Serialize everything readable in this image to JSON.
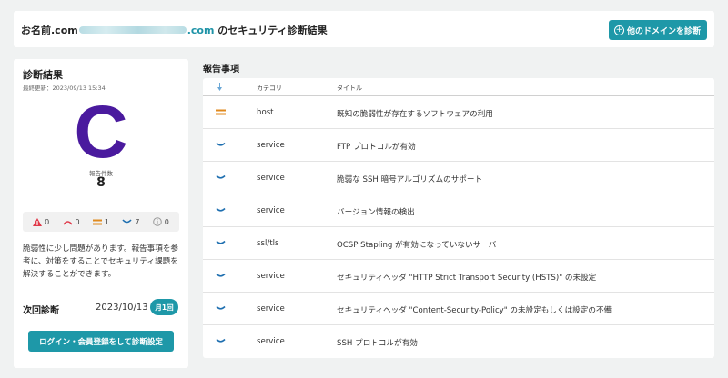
{
  "header": {
    "title_prefix": "お名前.com",
    "domain_suffix": ".com",
    "title_suffix": " のセキュリティ診断結果",
    "add_domain_button": "他のドメインを診断"
  },
  "summary_panel": {
    "title": "診断結果",
    "last_updated": "最終更新：2023/09/13 15:34",
    "grade": "C",
    "report_count_label": "報告件数",
    "report_count": "8",
    "severity_counts": [
      {
        "name": "critical",
        "icon": "warning-triangle-icon",
        "count": "0",
        "color": "#e03a4a"
      },
      {
        "name": "high",
        "icon": "high-arc-icon",
        "count": "0",
        "color": "#e03a4a"
      },
      {
        "name": "medium",
        "icon": "medium-equals-icon",
        "count": "1",
        "color": "#e08a1e"
      },
      {
        "name": "low",
        "icon": "low-chevron-icon",
        "count": "7",
        "color": "#1e6fb0"
      },
      {
        "name": "info",
        "icon": "info-circle-icon",
        "count": "0",
        "color": "#999999"
      }
    ],
    "summary_text": "脆弱性に少し問題があります。報告事項を参考に、対策をすることでセキュリティ課題を解決することができます。",
    "next_scan_label": "次回診断",
    "next_scan_date": "2023/10/13",
    "next_scan_badge": "月1回",
    "login_button": "ログイン・会員登録をして診断設定"
  },
  "report": {
    "section_title": "報告事項",
    "columns": {
      "category": "カテゴリ",
      "title": "タイトル"
    },
    "rows": [
      {
        "severity": "medium",
        "category": "host",
        "title": "既知の脆弱性が存在するソフトウェアの利用"
      },
      {
        "severity": "low",
        "category": "service",
        "title": "FTP プロトコルが有効"
      },
      {
        "severity": "low",
        "category": "service",
        "title": "脆弱な SSH 暗号アルゴリズムのサポート"
      },
      {
        "severity": "low",
        "category": "service",
        "title": "バージョン情報の検出"
      },
      {
        "severity": "low",
        "category": "ssl/tls",
        "title": "OCSP Stapling が有効になっていないサーバ"
      },
      {
        "severity": "low",
        "category": "service",
        "title": "セキュリティヘッダ \"HTTP Strict Transport Security (HSTS)\" の未設定"
      },
      {
        "severity": "low",
        "category": "service",
        "title": "セキュリティヘッダ \"Content-Security-Policy\" の未設定もしくは設定の不備"
      },
      {
        "severity": "low",
        "category": "service",
        "title": "SSH プロトコルが有効"
      }
    ]
  },
  "colors": {
    "accent": "#1e98a8",
    "grade": "#4a1a9e",
    "medium": "#e08a1e",
    "low": "#1e6fb0"
  }
}
